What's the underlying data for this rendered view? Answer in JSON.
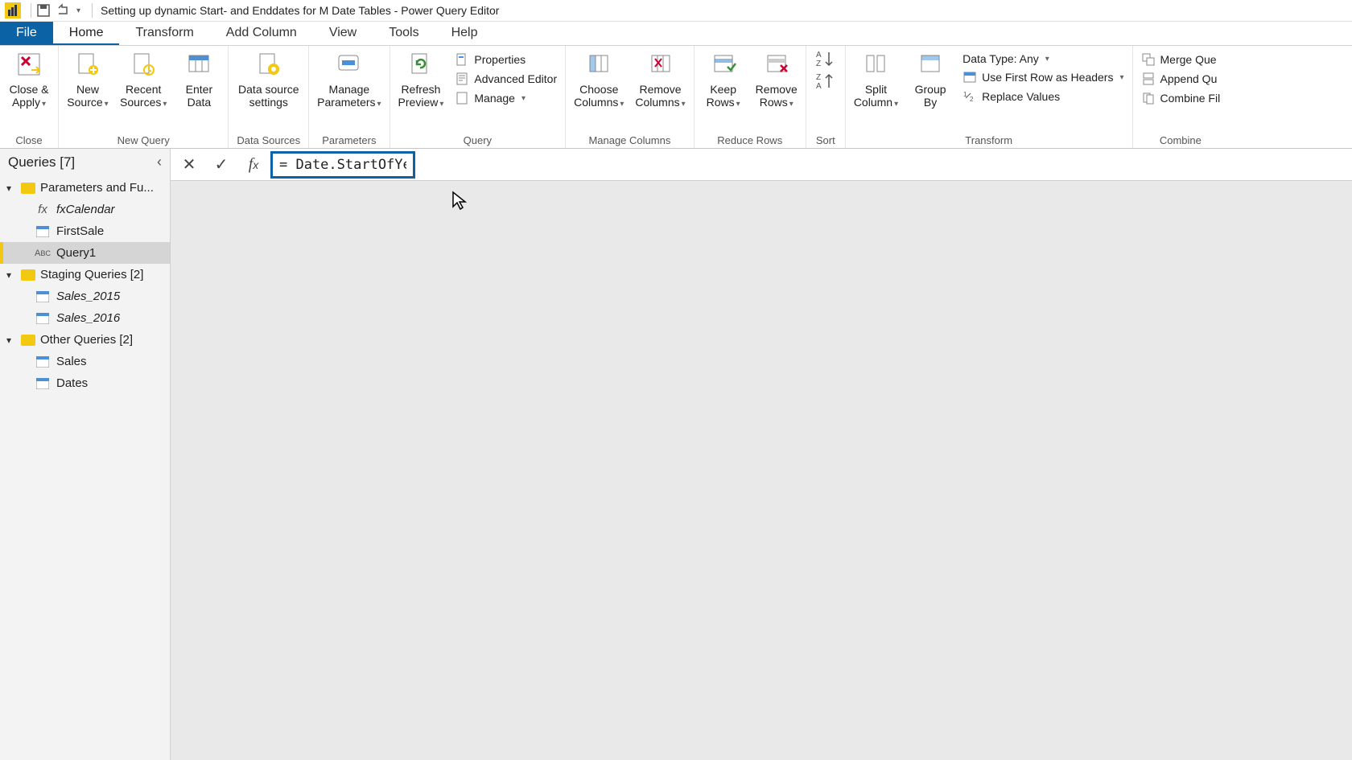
{
  "app": {
    "title": "Setting up dynamic Start- and Enddates for M Date Tables - Power Query Editor"
  },
  "tabs": {
    "file": "File",
    "home": "Home",
    "transform": "Transform",
    "add_column": "Add Column",
    "view": "View",
    "tools": "Tools",
    "help": "Help"
  },
  "ribbon": {
    "close_apply": "Close &\nApply",
    "close_group": "Close",
    "new_source": "New\nSource",
    "recent_sources": "Recent\nSources",
    "enter_data": "Enter\nData",
    "new_query_group": "New Query",
    "data_source_settings": "Data source\nsettings",
    "data_sources_group": "Data Sources",
    "manage_parameters": "Manage\nParameters",
    "parameters_group": "Parameters",
    "refresh_preview": "Refresh\nPreview",
    "properties": "Properties",
    "advanced_editor": "Advanced Editor",
    "manage": "Manage",
    "query_group": "Query",
    "choose_columns": "Choose\nColumns",
    "remove_columns": "Remove\nColumns",
    "manage_columns_group": "Manage Columns",
    "keep_rows": "Keep\nRows",
    "remove_rows": "Remove\nRows",
    "reduce_rows_group": "Reduce Rows",
    "sort_group": "Sort",
    "split_column": "Split\nColumn",
    "group_by": "Group\nBy",
    "data_type": "Data Type: Any",
    "first_row_headers": "Use First Row as Headers",
    "replace_values": "Replace Values",
    "transform_group": "Transform",
    "merge_queries": "Merge Que",
    "append_queries": "Append Qu",
    "combine_files": "Combine Fil",
    "combine_group": "Combine"
  },
  "sidebar": {
    "title": "Queries [7]",
    "folders": [
      {
        "label": "Parameters and Fu..."
      },
      {
        "label": "Staging Queries [2]"
      },
      {
        "label": "Other Queries [2]"
      }
    ],
    "queries": {
      "fx_calendar": "fxCalendar",
      "first_sale": "FirstSale",
      "query1": "Query1",
      "sales_2015": "Sales_2015",
      "sales_2016": "Sales_2016",
      "sales": "Sales",
      "dates": "Dates"
    }
  },
  "formula_bar": {
    "value": "= Date.StartOfYear"
  }
}
